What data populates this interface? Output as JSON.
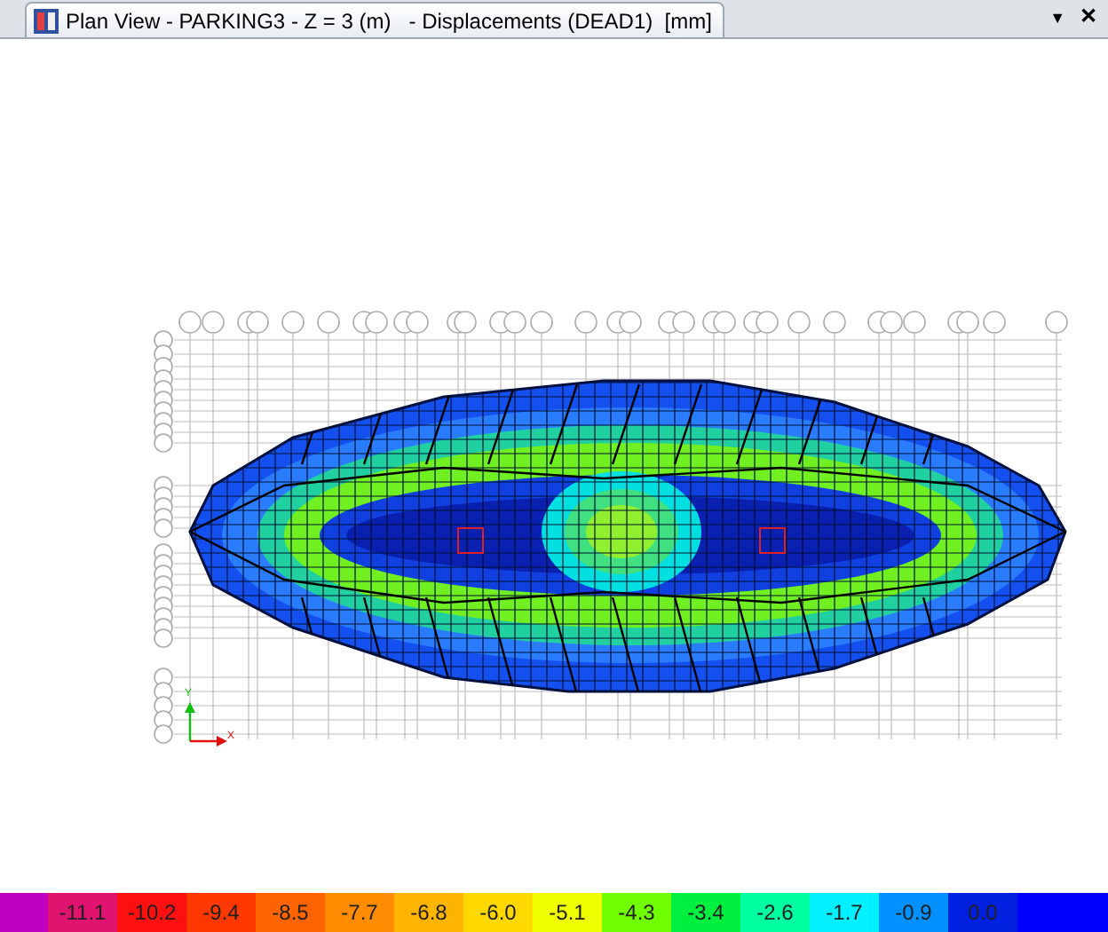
{
  "window": {
    "title": "Plan View - PARKING3 - Z = 3 (m)   - Displacements (DEAD1)  [mm]",
    "menu_glyph": "▼",
    "close_glyph": "✕"
  },
  "axes": {
    "y_label": "Y",
    "x_label": "X"
  },
  "legend": {
    "items": [
      {
        "kind": "swatch",
        "color": "#c000c0"
      },
      {
        "kind": "value",
        "label": "-11.1",
        "color": "#e0146e"
      },
      {
        "kind": "value",
        "label": "-10.2",
        "color": "#ff1010"
      },
      {
        "kind": "value",
        "label": "-9.4",
        "color": "#ff3800"
      },
      {
        "kind": "value",
        "label": "-8.5",
        "color": "#ff6400"
      },
      {
        "kind": "value",
        "label": "-7.7",
        "color": "#ff8c00"
      },
      {
        "kind": "value",
        "label": "-6.8",
        "color": "#ffb400"
      },
      {
        "kind": "value",
        "label": "-6.0",
        "color": "#ffd800"
      },
      {
        "kind": "value",
        "label": "-5.1",
        "color": "#f0ff00"
      },
      {
        "kind": "value",
        "label": "-4.3",
        "color": "#70ff00"
      },
      {
        "kind": "value",
        "label": "-3.4",
        "color": "#00f040"
      },
      {
        "kind": "value",
        "label": "-2.6",
        "color": "#00ffa0"
      },
      {
        "kind": "value",
        "label": "-1.7",
        "color": "#00f0ff"
      },
      {
        "kind": "value",
        "label": "-0.9",
        "color": "#0090ff"
      },
      {
        "kind": "value",
        "label": "0.0",
        "color": "#0020e0"
      },
      {
        "kind": "swatch",
        "color": "#0000ff"
      }
    ]
  }
}
